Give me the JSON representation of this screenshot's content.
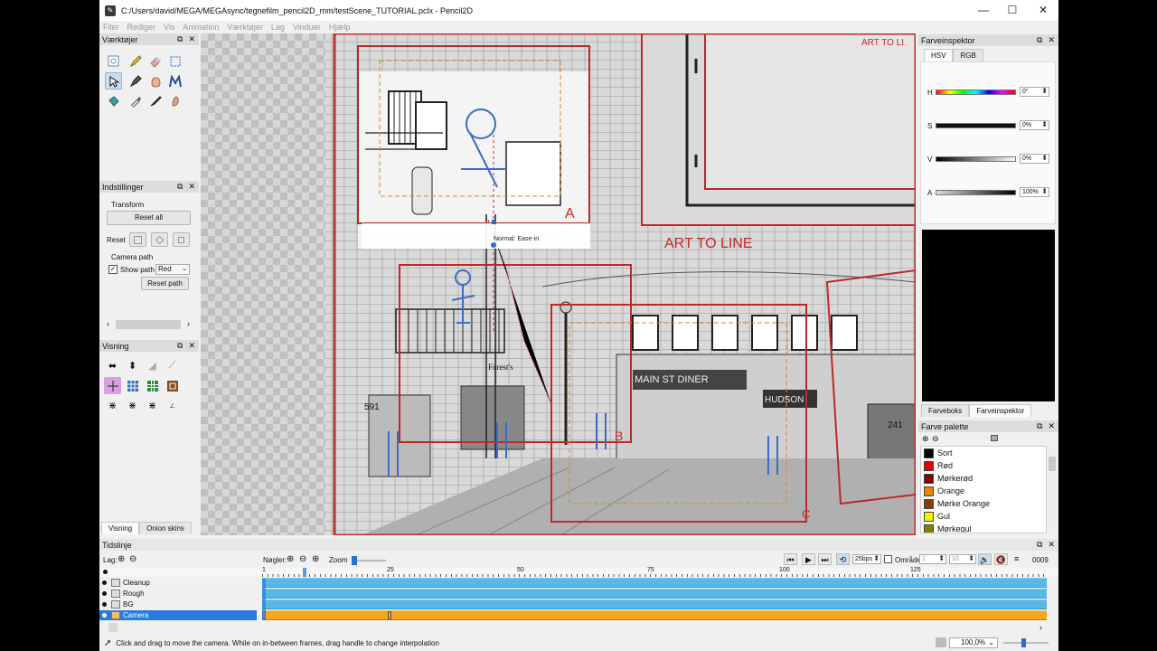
{
  "window": {
    "title": "C:/Users/david/MEGA/MEGAsync/tegnefilm_pencil2D_mm/testScene_TUTORIAL.pclx - Pencil2D",
    "minimize": "—",
    "maximize": "☐",
    "close": "✕"
  },
  "menu": [
    "Filer",
    "Rediger",
    "Vis",
    "Animation",
    "Værktøjer",
    "Lag",
    "Vinduer",
    "Hjælp"
  ],
  "tools_panel": {
    "title": "Værktøjer"
  },
  "settings_panel": {
    "title": "Indstillinger",
    "transform_label": "Transform",
    "reset_all": "Reset all",
    "reset_label": "Reset",
    "camera_path_label": "Camera path",
    "show_path_label": "Show path",
    "path_color": "Red",
    "reset_path": "Reset path"
  },
  "view_panel": {
    "title": "Visning",
    "tabs": [
      "Visning",
      "Onion skins"
    ]
  },
  "canvas": {
    "art_to_line_top": "ART TO LI",
    "art_to_line": "ART TO LINE",
    "camera_a": "A",
    "camera_b": "B",
    "camera_c": "C",
    "interp_label": "Normal: Ease-in",
    "sign_foresters": "Forest's",
    "sign_diner": "MAIN ST DINER",
    "sign_hudson": "HUDSON",
    "number_591": "591",
    "number_241": "241"
  },
  "color_inspector": {
    "title": "Farveinspektor",
    "tabs": [
      "HSV",
      "RGB"
    ],
    "channels": [
      {
        "label": "H",
        "value": "0°"
      },
      {
        "label": "S",
        "value": "0%"
      },
      {
        "label": "V",
        "value": "0%"
      },
      {
        "label": "A",
        "value": "100%"
      }
    ],
    "bottom_tabs": [
      "Farveboks",
      "Farveinspektor"
    ],
    "preview_color": "#000000"
  },
  "palette": {
    "title": "Farve palette",
    "colors": [
      {
        "name": "Sort",
        "hex": "#000000"
      },
      {
        "name": "Rød",
        "hex": "#e60000"
      },
      {
        "name": "Mørkerød",
        "hex": "#800000"
      },
      {
        "name": "Orange",
        "hex": "#f08000"
      },
      {
        "name": "Mørke Orange",
        "hex": "#804000"
      },
      {
        "name": "Gul",
        "hex": "#f0f000"
      },
      {
        "name": "Mørkegul",
        "hex": "#808000"
      }
    ]
  },
  "timeline": {
    "title": "Tidslinje",
    "layers_label": "Lag:",
    "keys_label": "Nøgler:",
    "zoom_label": "Zoom",
    "fps": "25bps",
    "range_label": "Område",
    "range_start": "1",
    "range_end": "10",
    "frame_counter": "0009",
    "ruler": [
      "1",
      "25",
      "50",
      "75",
      "100",
      "125"
    ],
    "layers": [
      {
        "name": "Cleanup",
        "selected": false
      },
      {
        "name": "Rough",
        "selected": false
      },
      {
        "name": "BG",
        "selected": false
      },
      {
        "name": "Camera",
        "selected": true
      }
    ]
  },
  "status": {
    "message": "Click and drag to move the camera. While on in-between frames, drag handle to change interpolation",
    "zoom": "100,0%"
  }
}
